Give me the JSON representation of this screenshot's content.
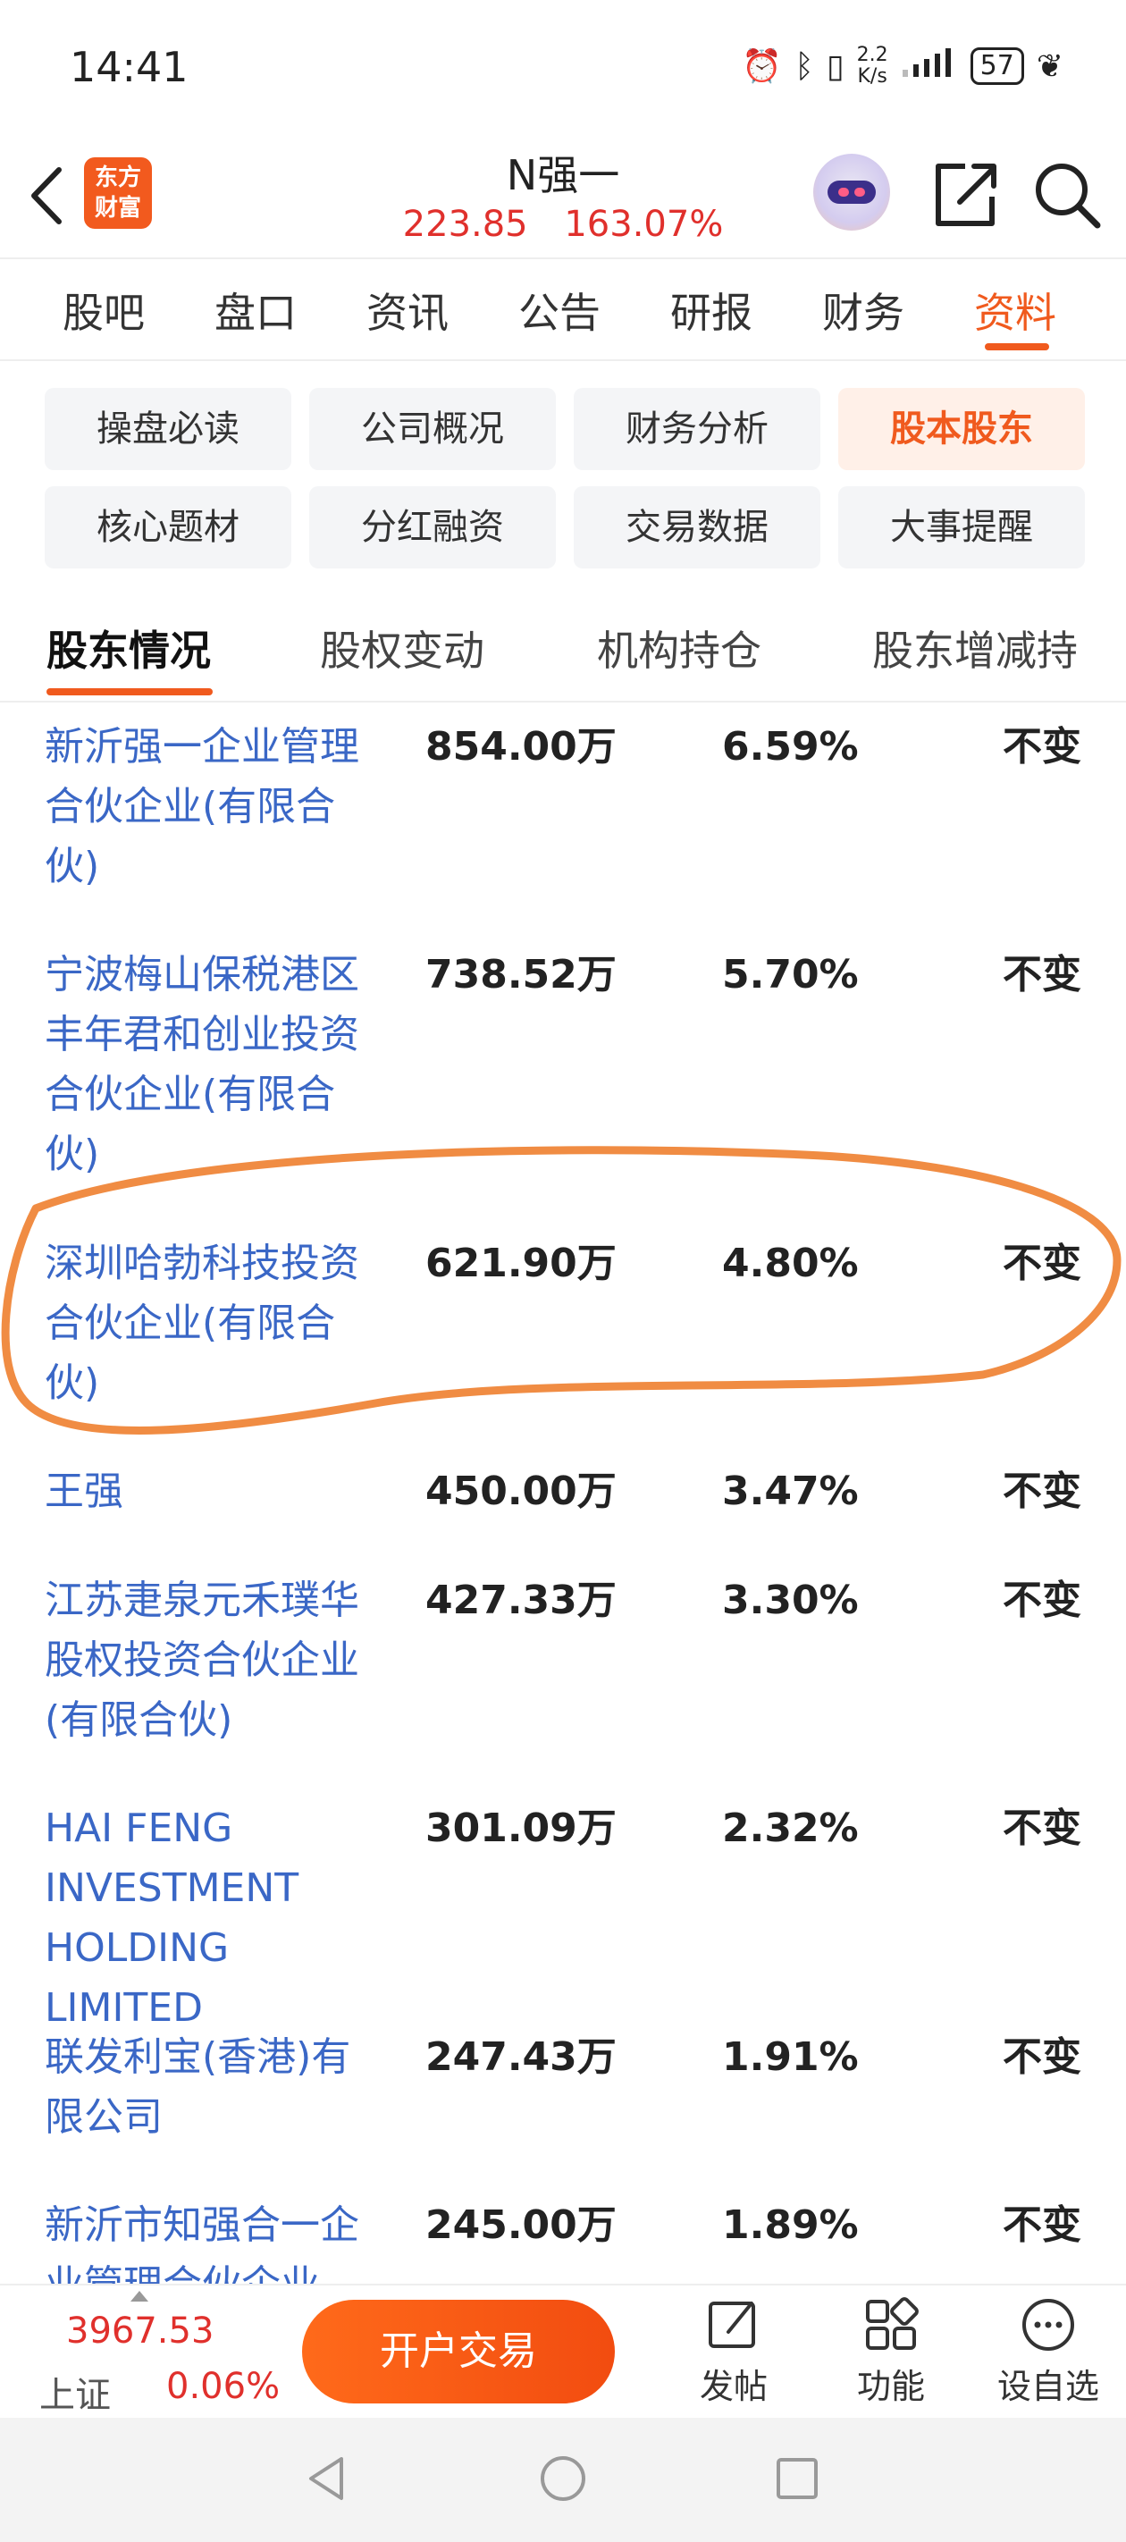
{
  "status_bar": {
    "time": "14:41",
    "net_speed_value": "2.2",
    "net_speed_unit": "K/s",
    "battery": "57"
  },
  "header": {
    "logo_line1": "东方",
    "logo_line2": "财富",
    "stock_name": "N强一",
    "price": "223.85",
    "change_pct": "163.07%"
  },
  "main_tabs": [
    "股吧",
    "盘口",
    "资讯",
    "公告",
    "研报",
    "财务",
    "资料"
  ],
  "sub_tabs": [
    "操盘必读",
    "公司概况",
    "财务分析",
    "股本股东",
    "核心题材",
    "分红融资",
    "交易数据",
    "大事提醒"
  ],
  "section_tabs": [
    "股东情况",
    "股权变动",
    "机构持仓",
    "股东增减持"
  ],
  "shareholders": [
    {
      "name": "新沂强一企业管理合伙企业(有限合伙)",
      "shares": "854.00万",
      "pct": "6.59%",
      "change": "不变"
    },
    {
      "name": "宁波梅山保税港区丰年君和创业投资合伙企业(有限合伙)",
      "shares": "738.52万",
      "pct": "5.70%",
      "change": "不变"
    },
    {
      "name": "深圳哈勃科技投资合伙企业(有限合伙)",
      "shares": "621.90万",
      "pct": "4.80%",
      "change": "不变"
    },
    {
      "name": "王强",
      "shares": "450.00万",
      "pct": "3.47%",
      "change": "不变"
    },
    {
      "name": "江苏疌泉元禾璞华股权投资合伙企业(有限合伙)",
      "shares": "427.33万",
      "pct": "3.30%",
      "change": "不变"
    },
    {
      "name": "HAI FENG INVESTMENT HOLDING LIMITED",
      "shares": "301.09万",
      "pct": "2.32%",
      "change": "不变"
    },
    {
      "name": "联发利宝(香港)有限公司",
      "shares": "247.43万",
      "pct": "1.91%",
      "change": "不变"
    },
    {
      "name": "新沂市知强合一企业管理合伙企业(有限合伙)",
      "shares": "245.00万",
      "pct": "1.89%",
      "change": "不变"
    }
  ],
  "bottom_bar": {
    "index_value": "3967.53",
    "index_name": "上证",
    "index_change": "0.06%",
    "trade_button": "开户交易",
    "post_label": "发帖",
    "function_label": "功能",
    "watchlist_label": "设自选"
  },
  "colors": {
    "accent": "#f05a1e",
    "rise": "#e0302c",
    "link": "#3a67c6",
    "highlight_loop": "#f08c43"
  }
}
